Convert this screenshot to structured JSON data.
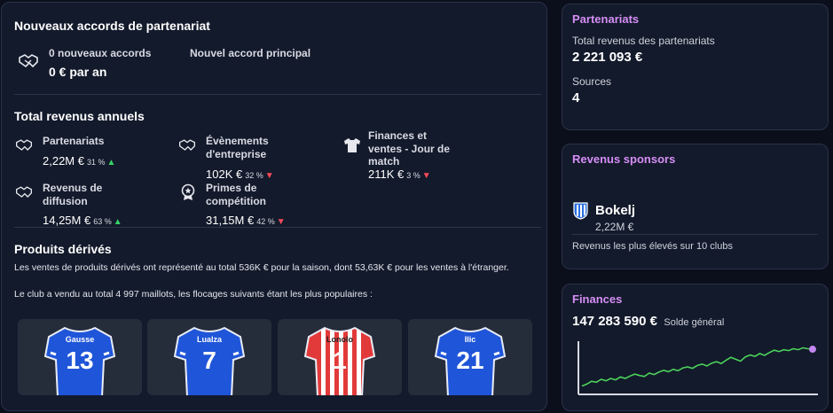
{
  "left": {
    "new_agreements": {
      "title": "Nouveaux accords de partenariat",
      "count_label": "0 nouveaux accords",
      "amount": "0 € par an",
      "main_label": "Nouvel accord principal"
    },
    "annual_revenue": {
      "title": "Total revenus annuels",
      "items": [
        {
          "label": "Partenariats",
          "value": "2,22M €",
          "pct": "31 %",
          "trend": "up",
          "icon": "handshake-icon"
        },
        {
          "label": "Évènements d'entreprise",
          "value": "102K €",
          "pct": "32 %",
          "trend": "down",
          "icon": "handshake-icon"
        },
        {
          "label": "Finances et ventes - Jour de match",
          "value": "211K €",
          "pct": "3 %",
          "trend": "down",
          "icon": "shirt-icon"
        },
        {
          "label": "Revenus de diffusion",
          "value": "14,25M €",
          "pct": "63 %",
          "trend": "up",
          "icon": "handshake-icon"
        },
        {
          "label": "Primes de compétition",
          "value": "31,15M €",
          "pct": "42 %",
          "trend": "down",
          "icon": "medal-icon"
        }
      ]
    },
    "merch": {
      "title": "Produits dérivés",
      "line1": "Les ventes de produits dérivés ont représenté au total 536K € pour la saison, dont 53,63K € pour les ventes à l'étranger.",
      "line2": "Le club a vendu au total 4 997 maillots, les flocages suivants étant les plus populaires :",
      "shirts": [
        {
          "name": "Gausse",
          "number": "13",
          "color": "#1f55d8"
        },
        {
          "name": "Lualza",
          "number": "7",
          "color": "#1f55d8"
        },
        {
          "name": "Lonolo",
          "number": "1",
          "color": "#e23a3a"
        },
        {
          "name": "Ilic",
          "number": "21",
          "color": "#1f55d8"
        }
      ]
    }
  },
  "partnerships": {
    "title": "Partenariats",
    "total_label": "Total revenus des partenariats",
    "total_value": "2 221 093 €",
    "sources_label": "Sources",
    "sources_value": "4"
  },
  "sponsors": {
    "title": "Revenus sponsors",
    "club_name": "Bokelj",
    "club_value": "2,22M €",
    "note": "Revenus les plus élevés sur 10 clubs"
  },
  "finances": {
    "title": "Finances",
    "balance": "147 283 590 €",
    "balance_label": "Solde général",
    "chart_data": {
      "type": "line",
      "values": [
        0.1,
        0.14,
        0.2,
        0.18,
        0.24,
        0.21,
        0.26,
        0.23,
        0.29,
        0.26,
        0.31,
        0.35,
        0.32,
        0.3,
        0.37,
        0.34,
        0.39,
        0.43,
        0.4,
        0.45,
        0.42,
        0.48,
        0.5,
        0.47,
        0.53,
        0.56,
        0.52,
        0.58,
        0.61,
        0.57,
        0.64,
        0.7,
        0.66,
        0.62,
        0.71,
        0.75,
        0.72,
        0.78,
        0.74,
        0.8,
        0.85,
        0.82,
        0.86,
        0.84,
        0.88,
        0.86,
        0.9,
        0.88,
        0.87
      ],
      "line_color": "#4bd15a",
      "end_marker_color": "#c487f0"
    }
  },
  "colors": {
    "accent_title": "#d58ef5",
    "up": "#37d36a",
    "down": "#ff4a5a"
  }
}
